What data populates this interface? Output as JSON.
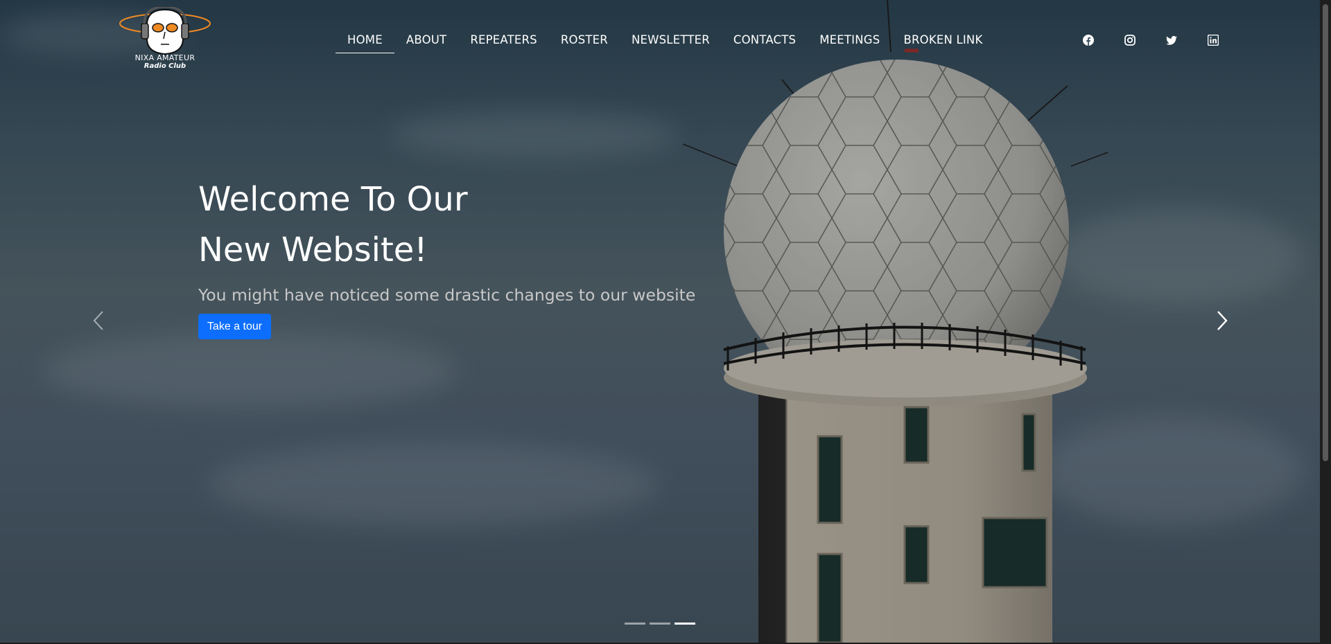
{
  "brand": {
    "line1": "NIXA AMATEUR",
    "line2": "Radio Club",
    "logo_icon": "radio-man-logo-icon",
    "accent_color": "#f08a24"
  },
  "nav": {
    "items": [
      {
        "label": "HOME",
        "active": true
      },
      {
        "label": "ABOUT"
      },
      {
        "label": "REPEATERS"
      },
      {
        "label": "ROSTER"
      },
      {
        "label": "NEWSLETTER"
      },
      {
        "label": "CONTACTS"
      },
      {
        "label": "MEETINGS"
      },
      {
        "label": "BROKEN LINK"
      }
    ]
  },
  "socials": [
    "facebook-icon",
    "instagram-icon",
    "twitter-icon",
    "linkedin-icon"
  ],
  "hero": {
    "title_line1": "Welcome To Our",
    "title_line2": "New Website!",
    "subtitle": "You might have noticed some drastic changes to our website",
    "button_label": "Take a tour",
    "button_color": "#0d6efd",
    "slide_count": 3,
    "active_slide": 3
  }
}
